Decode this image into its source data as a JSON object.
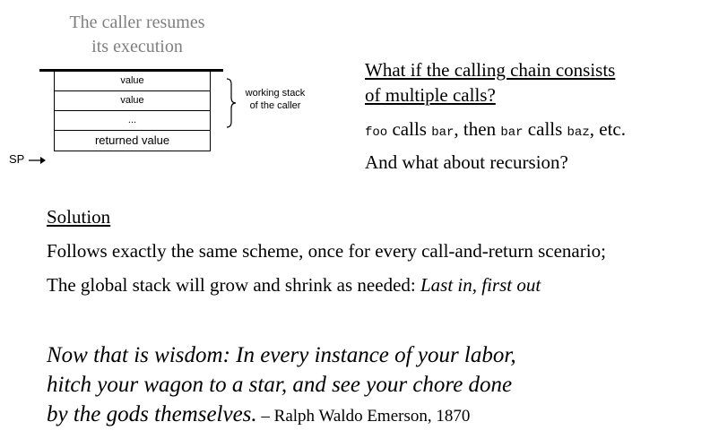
{
  "diagram": {
    "caption_line1": "The caller resumes",
    "caption_line2": "its execution",
    "cells": [
      "value",
      "value",
      "...",
      "returned value"
    ],
    "brace_label_line1": "working stack",
    "brace_label_line2": "of the caller",
    "sp_label": "SP"
  },
  "question": {
    "line1": "What if the calling chain consists",
    "line2": "of multiple calls?",
    "foo": "foo",
    "calls1": " calls ",
    "bar1": "bar",
    "then": ", then ",
    "bar2": "bar",
    "calls2": " calls ",
    "baz": "baz",
    "etc": ", etc.",
    "recursion": "And what about recursion?"
  },
  "solution": {
    "title": "Solution",
    "line1": "Follows exactly the same scheme, once for every call-and-return scenario;",
    "line2_plain": "The global stack will grow and shrink as needed: ",
    "line2_italic": "Last in, first out"
  },
  "quote": {
    "line1": "Now that is wisdom: In every instance of your labor,",
    "line2": "hitch your wagon to a star, and see your chore done",
    "line3": "by the gods themselves.",
    "attribution": " – Ralph Waldo Emerson, 1870"
  }
}
